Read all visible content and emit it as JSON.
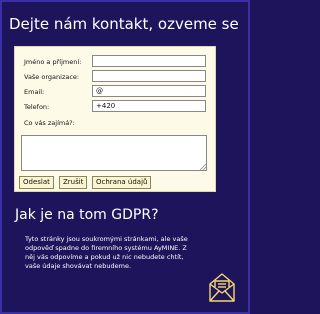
{
  "header": {
    "title": "Dejte nám kontakt, ozveme se"
  },
  "form": {
    "name_label": "Jméno a příjmení:",
    "org_label": "Vaše organizace:",
    "email_label": "Email:",
    "email_value": "@",
    "phone_label": "Telefon:",
    "phone_value": "+420",
    "interest_label": "Co vás zajímá?:",
    "submit_label": "Odeslat",
    "cancel_label": "Zrušit",
    "privacy_label": "Ochrana údajů"
  },
  "gdpr": {
    "title": "Jak je na tom GDPR?",
    "text": "Tyto stránky jsou soukromými stránkami, ale vaše odpověď spadne do firemního systému AyMINE. Z něj vás odpovíme a pokud už nic nebudete chtít, vaše údaje shovávat nebudeme."
  },
  "icons": {
    "mail": "mail-envelope-icon"
  },
  "colors": {
    "background": "#1d145c",
    "form_background": "#fdfbe8",
    "button_background": "#fbf6cf",
    "icon_color": "#f5d86a"
  }
}
